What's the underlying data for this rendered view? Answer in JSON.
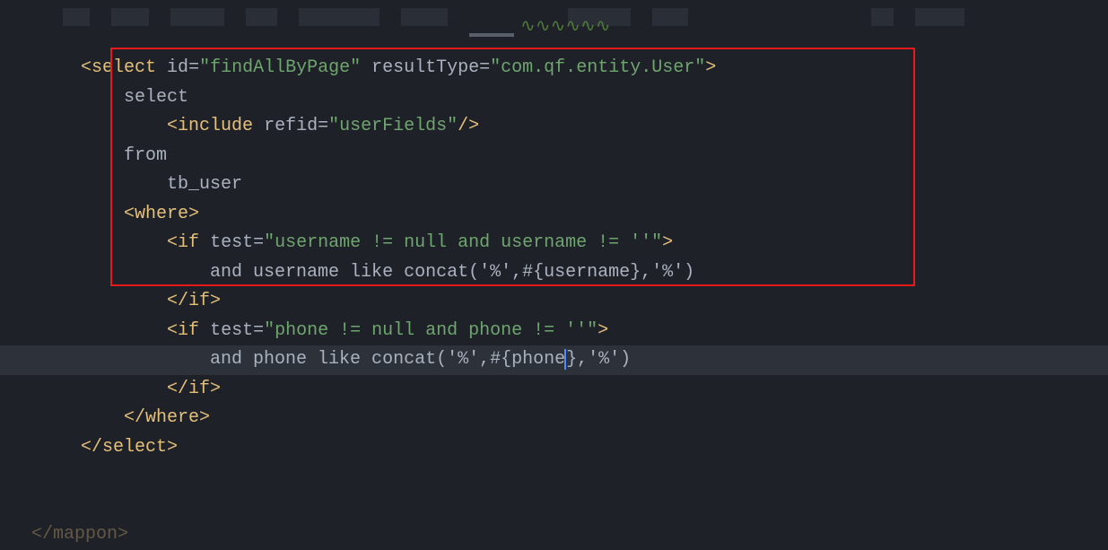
{
  "code": {
    "select_open": {
      "tag": "select",
      "attrs": {
        "id_name": "id",
        "id_val": "\"findAllByPage\"",
        "result_name": "resultType",
        "result_val": "\"com.qf.entity.User\""
      }
    },
    "select_text": "select",
    "include": {
      "tag": "include",
      "refid_name": "refid",
      "refid_val": "\"userFields\""
    },
    "from_text": "from",
    "tb_user": "tb_user",
    "where_tag": "where",
    "if1": {
      "tag": "if",
      "test_name": "test",
      "test_val": "\"username != null and username != ''\"",
      "body": "and username like concat('%',#{username},'%')"
    },
    "if2": {
      "tag": "if",
      "test_name": "test",
      "test_val": "\"phone != null and phone != ''\"",
      "body_part1": "and phone like concat('%',#{phone",
      "body_part2": "},'%')"
    },
    "select_close": "/select",
    "mapper_close": "</mappon>"
  }
}
